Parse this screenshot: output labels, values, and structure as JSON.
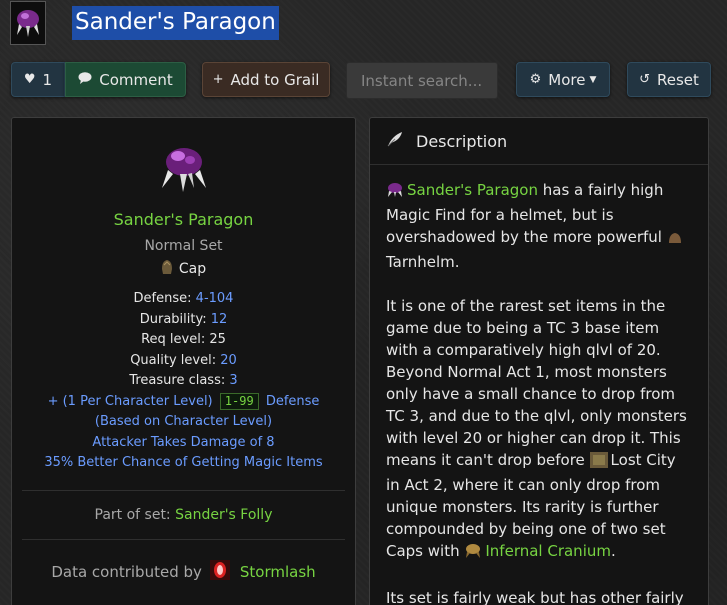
{
  "header": {
    "title": "Sander's Paragon",
    "thumb_icon": "helmet-icon"
  },
  "toolbar": {
    "like_count": "1",
    "comment_label": "Comment",
    "grail_label": "Add to Grail",
    "search_placeholder": "Instant search...",
    "more_label": "More",
    "reset_label": "Reset"
  },
  "item": {
    "name": "Sander's Paragon",
    "type": "Normal Set",
    "base": "Cap",
    "stats": [
      {
        "label": "Defense:",
        "value": "4-104"
      },
      {
        "label": "Durability:",
        "value": "12"
      },
      {
        "label": "Req level:",
        "value": "25"
      },
      {
        "label": "Quality level:",
        "value": "20"
      },
      {
        "label": "Treasure class:",
        "value": "3"
      }
    ],
    "prop_defense_prefix": "+ (1 Per Character Level)",
    "prop_defense_range": "1-99",
    "prop_defense_suffix": "Defense",
    "prop_defense_note": "(Based on Character Level)",
    "prop_attacker": "Attacker Takes Damage of 8",
    "prop_magic": "35% Better Chance of Getting Magic Items",
    "set_prefix": "Part of set:",
    "set_name": "Sander's Folly",
    "contrib_prefix": "Data contributed by",
    "contrib_user": "Stormlash"
  },
  "description": {
    "heading": "Description",
    "p1_link": "Sander's Paragon",
    "p1_text": "has a fairly high Magic Find for a helmet, but is overshadowed by the more powerful",
    "p1_link2": "Tarnhelm.",
    "p2_text_a": "It is one of the rarest set items in the game due to being a TC 3 base item with a comparatively high qlvl of 20. Beyond Normal Act 1, most monsters only have a small chance to drop from TC 3, and due to the qlvl, only monsters with level 20 or higher can drop it. This means it can't drop before",
    "p2_place": "Lost City",
    "p2_text_b": "in Act 2, where it can only drop from unique monsters. Its rarity is further compounded by being one of two set Caps with",
    "p2_link": "Infernal Cranium",
    "p2_end": ".",
    "p3_text": "Its set is fairly weak but has other fairly"
  }
}
